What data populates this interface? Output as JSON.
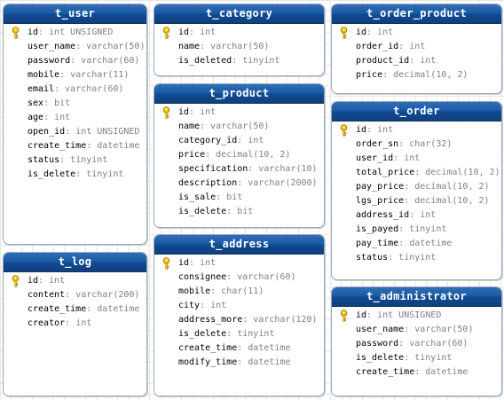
{
  "tables": [
    {
      "id": "t_user",
      "name": "t_user",
      "fields": [
        {
          "name": "id",
          "type": "int UNSIGNED",
          "pk": true
        },
        {
          "name": "user_name",
          "type": "varchar(50)"
        },
        {
          "name": "password",
          "type": "varchar(60)"
        },
        {
          "name": "mobile",
          "type": "varchar(11)"
        },
        {
          "name": "email",
          "type": "varchar(60)"
        },
        {
          "name": "sex",
          "type": "bit"
        },
        {
          "name": "age",
          "type": "int"
        },
        {
          "name": "open_id",
          "type": "int UNSIGNED"
        },
        {
          "name": "create_time",
          "type": "datetime"
        },
        {
          "name": "status",
          "type": "tinyint"
        },
        {
          "name": "is_delete",
          "type": "tinyint"
        }
      ]
    },
    {
      "id": "t_category",
      "name": "t_category",
      "fields": [
        {
          "name": "id",
          "type": "int",
          "pk": true
        },
        {
          "name": "name",
          "type": "varchar(50)"
        },
        {
          "name": "is_deleted",
          "type": "tinyint"
        }
      ]
    },
    {
      "id": "t_order_product",
      "name": "t_order_product",
      "fields": [
        {
          "name": "id",
          "type": "int",
          "pk": true
        },
        {
          "name": "order_id",
          "type": "int"
        },
        {
          "name": "product_id",
          "type": "int"
        },
        {
          "name": "price",
          "type": "decimal(10, 2)"
        }
      ]
    },
    {
      "id": "t_product",
      "name": "t_product",
      "fields": [
        {
          "name": "id",
          "type": "int",
          "pk": true
        },
        {
          "name": "name",
          "type": "varchar(50)"
        },
        {
          "name": "category_id",
          "type": "int"
        },
        {
          "name": "price",
          "type": "decimal(10, 2)"
        },
        {
          "name": "specification",
          "type": "varchar(10)"
        },
        {
          "name": "description",
          "type": "varchar(2000)"
        },
        {
          "name": "is_sale",
          "type": "bit"
        },
        {
          "name": "is_delete",
          "type": "bit"
        }
      ]
    },
    {
      "id": "t_order",
      "name": "t_order",
      "fields": [
        {
          "name": "id",
          "type": "int",
          "pk": true
        },
        {
          "name": "order_sn",
          "type": "char(32)"
        },
        {
          "name": "user_id",
          "type": "int"
        },
        {
          "name": "total_price",
          "type": "decimal(10, 2)"
        },
        {
          "name": "pay_price",
          "type": "decimal(10, 2)"
        },
        {
          "name": "lgs_price",
          "type": "decimal(10, 2)"
        },
        {
          "name": "address_id",
          "type": "int"
        },
        {
          "name": "is_payed",
          "type": "tinyint"
        },
        {
          "name": "pay_time",
          "type": "datetime"
        },
        {
          "name": "status",
          "type": "tinyint"
        }
      ]
    },
    {
      "id": "t_address",
      "name": "t_address",
      "fields": [
        {
          "name": "id",
          "type": "int",
          "pk": true
        },
        {
          "name": "consignee",
          "type": "varchar(60)"
        },
        {
          "name": "mobile",
          "type": "char(11)"
        },
        {
          "name": "city",
          "type": "int"
        },
        {
          "name": "address_more",
          "type": "varchar(120)"
        },
        {
          "name": "is_delete",
          "type": "tinyint"
        },
        {
          "name": "create_time",
          "type": "datetime"
        },
        {
          "name": "modify_time",
          "type": "datetime"
        }
      ]
    },
    {
      "id": "t_log",
      "name": "t_log",
      "fields": [
        {
          "name": "id",
          "type": "int",
          "pk": true
        },
        {
          "name": "content",
          "type": "varchar(200)"
        },
        {
          "name": "create_time",
          "type": "datetime"
        },
        {
          "name": "creator",
          "type": "int"
        }
      ]
    },
    {
      "id": "t_administrator",
      "name": "t_administrator",
      "fields": [
        {
          "name": "id",
          "type": "int UNSIGNED",
          "pk": true
        },
        {
          "name": "user_name",
          "type": "varchar(50)"
        },
        {
          "name": "password",
          "type": "varchar(60)"
        },
        {
          "name": "is_delete",
          "type": "tinyint"
        },
        {
          "name": "create_time",
          "type": "datetime"
        }
      ]
    }
  ],
  "colors": {
    "header_gradient_top": "#2f6fb6",
    "header_gradient_bottom": "#123f7a",
    "field_type": "#808080",
    "key_icon": "#f2c200"
  },
  "icons": {
    "primary_key": "key-icon"
  }
}
